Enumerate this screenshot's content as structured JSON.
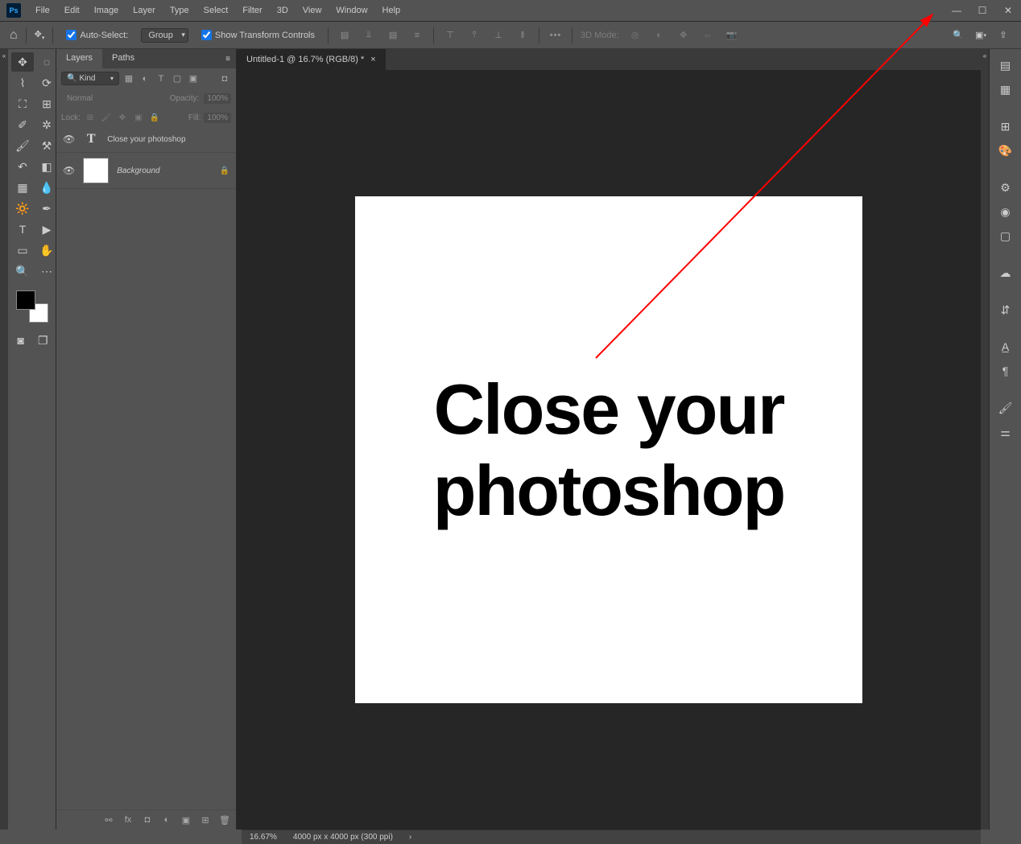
{
  "menubar": [
    "File",
    "Edit",
    "Image",
    "Layer",
    "Type",
    "Select",
    "Filter",
    "3D",
    "View",
    "Window",
    "Help"
  ],
  "options": {
    "auto_select_label": "Auto-Select:",
    "group_label": "Group",
    "show_transform_label": "Show Transform Controls",
    "mode_3d_label": "3D Mode:"
  },
  "layers_panel": {
    "tab_layers": "Layers",
    "tab_paths": "Paths",
    "kind_label": "Kind",
    "blend_mode": "Normal",
    "opacity_label": "Opacity:",
    "opacity_value": "100%",
    "lock_label": "Lock:",
    "fill_label": "Fill:",
    "fill_value": "100%",
    "layers": [
      {
        "name": "Close your  photoshop",
        "type": "text",
        "locked": false
      },
      {
        "name": "Background",
        "type": "image",
        "locked": true
      }
    ]
  },
  "document": {
    "tab_label": "Untitled-1 @ 16.7% (RGB/8) *",
    "canvas_text_line1": "Close your",
    "canvas_text_line2": "photoshop"
  },
  "status": {
    "zoom": "16.67%",
    "dims": "4000 px x 4000 px (300 ppi)"
  }
}
